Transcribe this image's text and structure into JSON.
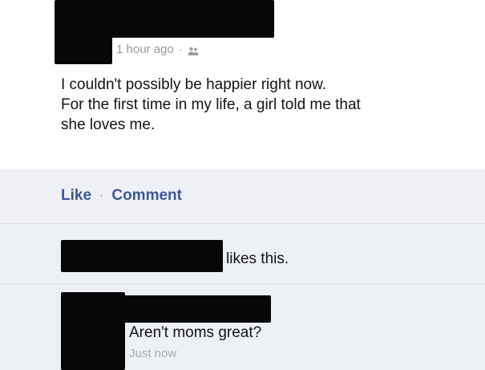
{
  "post": {
    "timestamp": "1 hour ago",
    "separator": "·",
    "audience_icon": "friends-icon",
    "text_lines": [
      "I couldn't possibly be happier right now.",
      "For the first time in my life, a girl told me that",
      "she loves me."
    ]
  },
  "actions": {
    "like_label": "Like",
    "separator": "·",
    "comment_label": "Comment"
  },
  "likes": {
    "text": "likes this."
  },
  "comment": {
    "text": "Aren't moms great?",
    "timestamp": "Just now"
  },
  "colors": {
    "link": "#3b5998",
    "feedback_bg": "#edf0f5",
    "redaction": "#070707",
    "muted_text": "#9a9a9a"
  }
}
